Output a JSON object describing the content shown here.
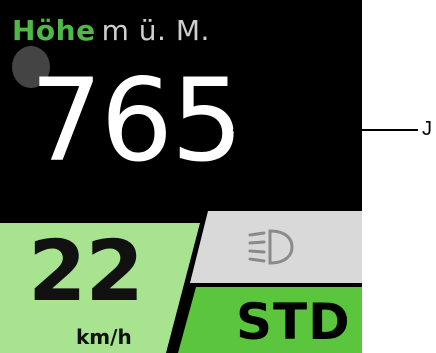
{
  "altitude": {
    "label": "Höhe",
    "unit": "m ü. M.",
    "value": "765"
  },
  "speed": {
    "value": "22",
    "unit": "km/h"
  },
  "light": {
    "icon": "headlight-icon"
  },
  "mode": {
    "label": "STD"
  },
  "callout": {
    "letter": "J"
  },
  "colors": {
    "display_bg": "#000000",
    "accent_green": "#4fb848",
    "speed_panel": "#a8e38f",
    "mode_panel": "#5bc63d",
    "light_panel": "#d9d9d9"
  }
}
